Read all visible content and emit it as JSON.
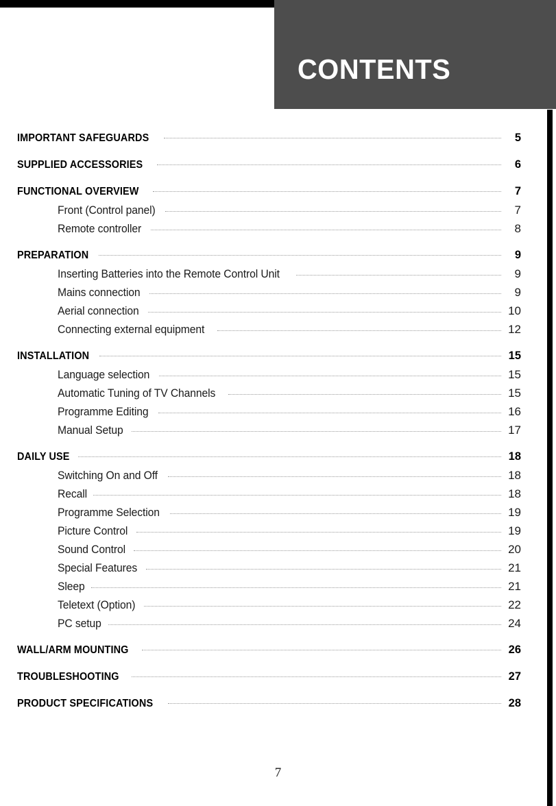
{
  "header": {
    "title": "CONTENTS",
    "panel_color": "#4d4d4d",
    "title_color": "#ffffff"
  },
  "footer": {
    "page_number": "7"
  },
  "toc": {
    "entries": [
      {
        "level": 1,
        "label": "IMPORTANT SAFEGUARDS",
        "page": "5"
      },
      {
        "level": 1,
        "label": "SUPPLIED ACCESSORIES",
        "page": "6"
      },
      {
        "level": 1,
        "label": "FUNCTIONAL OVERVIEW",
        "page": "7"
      },
      {
        "level": 2,
        "label": "Front (Control panel)",
        "page": "7"
      },
      {
        "level": 2,
        "label": "Remote controller",
        "page": "8"
      },
      {
        "level": 1,
        "label": "PREPARATION",
        "page": "9"
      },
      {
        "level": 2,
        "label": "Inserting Batteries into the Remote Control Unit",
        "page": "9"
      },
      {
        "level": 2,
        "label": "Mains connection",
        "page": "9"
      },
      {
        "level": 2,
        "label": "Aerial connection",
        "page": "10"
      },
      {
        "level": 2,
        "label": "Connecting external equipment",
        "page": "12"
      },
      {
        "level": 1,
        "label": "INSTALLATION",
        "page": "15"
      },
      {
        "level": 2,
        "label": "Language selection",
        "page": "15"
      },
      {
        "level": 2,
        "label": "Automatic Tuning of TV Channels",
        "page": "15"
      },
      {
        "level": 2,
        "label": "Programme Editing",
        "page": "16"
      },
      {
        "level": 2,
        "label": "Manual Setup",
        "page": "17"
      },
      {
        "level": 1,
        "label": "DAILY USE",
        "page": "18"
      },
      {
        "level": 2,
        "label": "Switching On and Off",
        "page": "18"
      },
      {
        "level": 2,
        "label": "Recall",
        "page": "18"
      },
      {
        "level": 2,
        "label": "Programme Selection",
        "page": "19"
      },
      {
        "level": 2,
        "label": "Picture Control",
        "page": "19"
      },
      {
        "level": 2,
        "label": "Sound Control",
        "page": "20"
      },
      {
        "level": 2,
        "label": "Special Features",
        "page": "21"
      },
      {
        "level": 2,
        "label": "Sleep",
        "page": "21"
      },
      {
        "level": 2,
        "label": "Teletext (Option)",
        "page": "22"
      },
      {
        "level": 2,
        "label": "PC setup",
        "page": "24"
      },
      {
        "level": 1,
        "label": "WALL/ARM MOUNTING",
        "page": "26"
      },
      {
        "level": 1,
        "label": "TROUBLESHOOTING",
        "page": "27"
      },
      {
        "level": 1,
        "label": "PRODUCT SPECIFICATIONS",
        "page": "28"
      }
    ]
  }
}
